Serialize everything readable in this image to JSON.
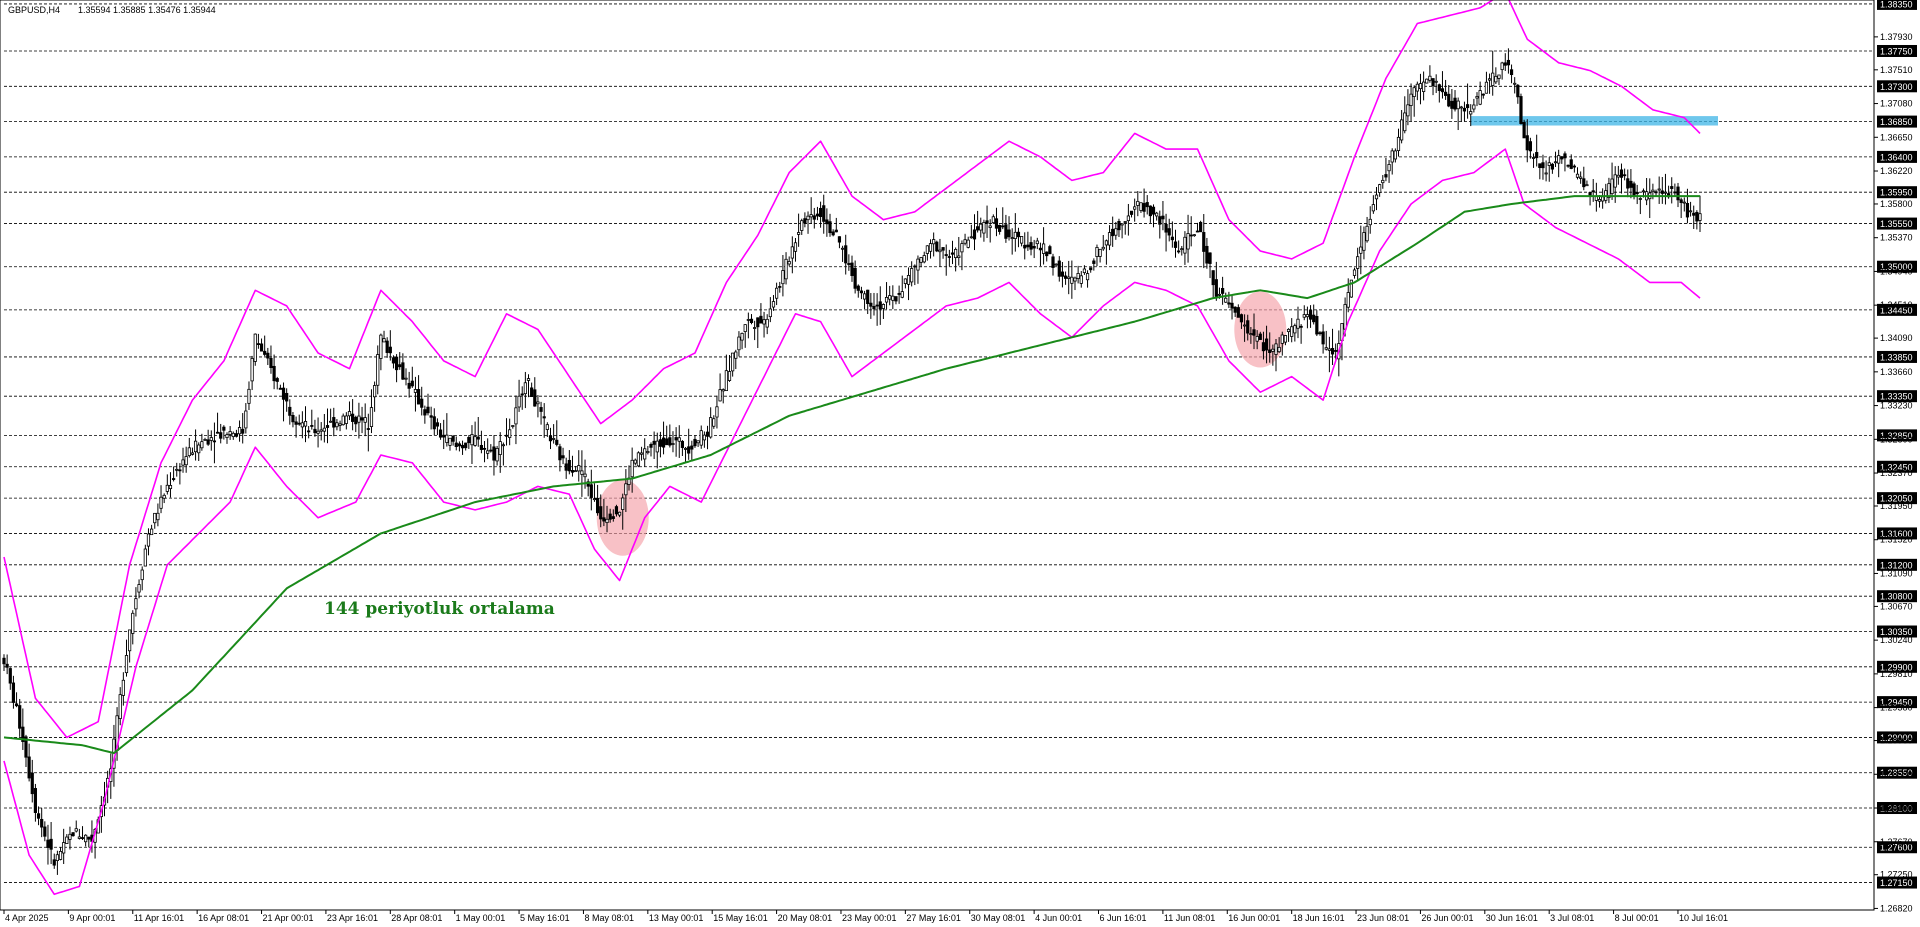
{
  "header": {
    "symbol": "GBPUSD,H4",
    "ohlc": "1.35594 1.35885 1.35476 1.35944"
  },
  "annotation": {
    "ma_label": "144 periyotluk ortalama"
  },
  "colors": {
    "candle": "#000000",
    "bollinger": "#ff00ff",
    "ma": "#1a8a1a",
    "resistance_band": "#3db4e6",
    "highlight": "#f4a0a8"
  },
  "chart_data": {
    "type": "candlestick",
    "symbol": "GBPUSD,H4",
    "ylim": [
      1.268,
      1.384
    ],
    "grid": "horizontal dashed at level lines",
    "y_levels": [
      "1.38350",
      "1.37750",
      "1.37300",
      "1.36850",
      "1.36400",
      "1.35950",
      "1.35550",
      "1.35000",
      "1.34450",
      "1.33850",
      "1.33350",
      "1.32850",
      "1.32450",
      "1.32050",
      "1.31600",
      "1.31200",
      "1.30800",
      "1.30350",
      "1.29900",
      "1.29450",
      "1.29000",
      "1.28550",
      "1.28100",
      "1.27600",
      "1.27150"
    ],
    "y_ticks": [
      "1.37930",
      "1.37510",
      "1.37080",
      "1.36650",
      "1.36220",
      "1.35800",
      "1.35370",
      "1.34940",
      "1.34510",
      "1.34090",
      "1.33660",
      "1.33230",
      "1.32800",
      "1.32370",
      "1.31950",
      "1.31520",
      "1.31090",
      "1.30670",
      "1.30240",
      "1.29810",
      "1.29380",
      "1.28960",
      "1.28530",
      "1.28100",
      "1.27670",
      "1.27250",
      "1.26820"
    ],
    "x_labels": [
      "4 Apr 2025",
      "9 Apr 00:01",
      "11 Apr 16:01",
      "16 Apr 08:01",
      "21 Apr 00:01",
      "23 Apr 16:01",
      "28 Apr 08:01",
      "1 May 00:01",
      "5 May 16:01",
      "8 May 08:01",
      "13 May 00:01",
      "15 May 16:01",
      "20 May 08:01",
      "23 May 00:01",
      "27 May 16:01",
      "30 May 08:01",
      "4 Jun 00:01",
      "6 Jun 16:01",
      "11 Jun 08:01",
      "16 Jun 00:01",
      "18 Jun 16:01",
      "23 Jun 08:01",
      "26 Jun 00:01",
      "30 Jun 16:01",
      "3 Jul 08:01",
      "8 Jul 00:01",
      "10 Jul 16:01"
    ],
    "price_path": [
      [
        0,
        1.3
      ],
      [
        6,
        1.29
      ],
      [
        10,
        1.281
      ],
      [
        16,
        1.274
      ],
      [
        22,
        1.278
      ],
      [
        28,
        1.277
      ],
      [
        34,
        1.286
      ],
      [
        40,
        1.304
      ],
      [
        46,
        1.316
      ],
      [
        52,
        1.322
      ],
      [
        58,
        1.326
      ],
      [
        64,
        1.328
      ],
      [
        70,
        1.329
      ],
      [
        76,
        1.329
      ],
      [
        80,
        1.341
      ],
      [
        86,
        1.336
      ],
      [
        92,
        1.331
      ],
      [
        98,
        1.329
      ],
      [
        104,
        1.33
      ],
      [
        110,
        1.331
      ],
      [
        116,
        1.33
      ],
      [
        120,
        1.341
      ],
      [
        126,
        1.337
      ],
      [
        132,
        1.333
      ],
      [
        138,
        1.329
      ],
      [
        144,
        1.327
      ],
      [
        150,
        1.328
      ],
      [
        156,
        1.326
      ],
      [
        162,
        1.33
      ],
      [
        166,
        1.336
      ],
      [
        172,
        1.33
      ],
      [
        178,
        1.325
      ],
      [
        184,
        1.324
      ],
      [
        190,
        1.318
      ],
      [
        196,
        1.319
      ],
      [
        200,
        1.325
      ],
      [
        206,
        1.327
      ],
      [
        212,
        1.328
      ],
      [
        218,
        1.327
      ],
      [
        224,
        1.329
      ],
      [
        230,
        1.336
      ],
      [
        236,
        1.343
      ],
      [
        242,
        1.343
      ],
      [
        248,
        1.349
      ],
      [
        254,
        1.356
      ],
      [
        260,
        1.357
      ],
      [
        266,
        1.353
      ],
      [
        272,
        1.347
      ],
      [
        278,
        1.345
      ],
      [
        284,
        1.346
      ],
      [
        290,
        1.35
      ],
      [
        296,
        1.353
      ],
      [
        302,
        1.351
      ],
      [
        308,
        1.354
      ],
      [
        314,
        1.356
      ],
      [
        320,
        1.354
      ],
      [
        326,
        1.353
      ],
      [
        332,
        1.352
      ],
      [
        338,
        1.348
      ],
      [
        344,
        1.349
      ],
      [
        350,
        1.353
      ],
      [
        356,
        1.356
      ],
      [
        362,
        1.358
      ],
      [
        368,
        1.356
      ],
      [
        374,
        1.352
      ],
      [
        380,
        1.355
      ],
      [
        386,
        1.347
      ],
      [
        392,
        1.344
      ],
      [
        398,
        1.341
      ],
      [
        404,
        1.339
      ],
      [
        410,
        1.342
      ],
      [
        416,
        1.344
      ],
      [
        420,
        1.34
      ],
      [
        424,
        1.339
      ],
      [
        430,
        1.35
      ],
      [
        436,
        1.358
      ],
      [
        442,
        1.364
      ],
      [
        448,
        1.372
      ],
      [
        454,
        1.374
      ],
      [
        460,
        1.371
      ],
      [
        466,
        1.37
      ],
      [
        472,
        1.373
      ],
      [
        478,
        1.376
      ],
      [
        482,
        1.372
      ],
      [
        484,
        1.366
      ],
      [
        490,
        1.362
      ],
      [
        496,
        1.364
      ],
      [
        502,
        1.361
      ],
      [
        508,
        1.358
      ],
      [
        514,
        1.362
      ],
      [
        520,
        1.359
      ],
      [
        526,
        1.359
      ],
      [
        532,
        1.36
      ],
      [
        536,
        1.357
      ],
      [
        540,
        1.356
      ]
    ],
    "candle_count": 541,
    "xlim_index": [
      0,
      540
    ],
    "ma_path": [
      [
        0,
        1.29
      ],
      [
        25,
        1.289
      ],
      [
        35,
        1.288
      ],
      [
        60,
        1.296
      ],
      [
        90,
        1.309
      ],
      [
        120,
        1.316
      ],
      [
        150,
        1.32
      ],
      [
        175,
        1.322
      ],
      [
        200,
        1.323
      ],
      [
        225,
        1.326
      ],
      [
        250,
        1.331
      ],
      [
        275,
        1.334
      ],
      [
        300,
        1.337
      ],
      [
        330,
        1.34
      ],
      [
        360,
        1.343
      ],
      [
        385,
        1.346
      ],
      [
        400,
        1.347
      ],
      [
        415,
        1.346
      ],
      [
        430,
        1.348
      ],
      [
        450,
        1.353
      ],
      [
        465,
        1.357
      ],
      [
        480,
        1.358
      ],
      [
        500,
        1.359
      ],
      [
        520,
        1.359
      ],
      [
        540,
        1.359
      ]
    ],
    "bollinger_upper": [
      [
        0,
        1.313
      ],
      [
        10,
        1.295
      ],
      [
        20,
        1.29
      ],
      [
        30,
        1.292
      ],
      [
        40,
        1.312
      ],
      [
        50,
        1.325
      ],
      [
        60,
        1.333
      ],
      [
        70,
        1.338
      ],
      [
        80,
        1.347
      ],
      [
        90,
        1.345
      ],
      [
        100,
        1.339
      ],
      [
        110,
        1.337
      ],
      [
        120,
        1.347
      ],
      [
        130,
        1.343
      ],
      [
        140,
        1.338
      ],
      [
        150,
        1.336
      ],
      [
        160,
        1.344
      ],
      [
        170,
        1.342
      ],
      [
        180,
        1.336
      ],
      [
        190,
        1.33
      ],
      [
        200,
        1.333
      ],
      [
        210,
        1.337
      ],
      [
        220,
        1.339
      ],
      [
        230,
        1.348
      ],
      [
        240,
        1.354
      ],
      [
        250,
        1.362
      ],
      [
        260,
        1.366
      ],
      [
        270,
        1.359
      ],
      [
        280,
        1.356
      ],
      [
        290,
        1.357
      ],
      [
        300,
        1.36
      ],
      [
        310,
        1.363
      ],
      [
        320,
        1.366
      ],
      [
        330,
        1.364
      ],
      [
        340,
        1.361
      ],
      [
        350,
        1.362
      ],
      [
        360,
        1.367
      ],
      [
        370,
        1.365
      ],
      [
        380,
        1.365
      ],
      [
        390,
        1.356
      ],
      [
        400,
        1.352
      ],
      [
        410,
        1.351
      ],
      [
        420,
        1.353
      ],
      [
        430,
        1.364
      ],
      [
        440,
        1.374
      ],
      [
        450,
        1.381
      ],
      [
        460,
        1.382
      ],
      [
        470,
        1.383
      ],
      [
        478,
        1.385
      ],
      [
        485,
        1.379
      ],
      [
        495,
        1.376
      ],
      [
        505,
        1.375
      ],
      [
        515,
        1.373
      ],
      [
        525,
        1.37
      ],
      [
        535,
        1.369
      ],
      [
        540,
        1.367
      ]
    ],
    "bollinger_lower": [
      [
        0,
        1.287
      ],
      [
        8,
        1.275
      ],
      [
        16,
        1.27
      ],
      [
        24,
        1.271
      ],
      [
        32,
        1.282
      ],
      [
        42,
        1.299
      ],
      [
        52,
        1.312
      ],
      [
        62,
        1.316
      ],
      [
        72,
        1.32
      ],
      [
        80,
        1.327
      ],
      [
        90,
        1.322
      ],
      [
        100,
        1.318
      ],
      [
        112,
        1.32
      ],
      [
        120,
        1.326
      ],
      [
        130,
        1.325
      ],
      [
        140,
        1.32
      ],
      [
        150,
        1.319
      ],
      [
        160,
        1.32
      ],
      [
        170,
        1.322
      ],
      [
        180,
        1.321
      ],
      [
        188,
        1.314
      ],
      [
        196,
        1.31
      ],
      [
        204,
        1.318
      ],
      [
        212,
        1.322
      ],
      [
        222,
        1.32
      ],
      [
        232,
        1.328
      ],
      [
        242,
        1.336
      ],
      [
        252,
        1.344
      ],
      [
        260,
        1.343
      ],
      [
        270,
        1.336
      ],
      [
        280,
        1.339
      ],
      [
        290,
        1.342
      ],
      [
        300,
        1.345
      ],
      [
        310,
        1.346
      ],
      [
        320,
        1.348
      ],
      [
        330,
        1.344
      ],
      [
        340,
        1.341
      ],
      [
        350,
        1.345
      ],
      [
        360,
        1.348
      ],
      [
        370,
        1.347
      ],
      [
        380,
        1.345
      ],
      [
        390,
        1.338
      ],
      [
        400,
        1.334
      ],
      [
        410,
        1.336
      ],
      [
        420,
        1.333
      ],
      [
        428,
        1.343
      ],
      [
        438,
        1.352
      ],
      [
        448,
        1.358
      ],
      [
        458,
        1.361
      ],
      [
        468,
        1.362
      ],
      [
        478,
        1.365
      ],
      [
        484,
        1.358
      ],
      [
        494,
        1.355
      ],
      [
        504,
        1.353
      ],
      [
        514,
        1.351
      ],
      [
        524,
        1.348
      ],
      [
        534,
        1.348
      ],
      [
        540,
        1.346
      ]
    ],
    "resistance_band": {
      "from_index": 467,
      "to_index": 540,
      "y_low": 1.368,
      "y_high": 1.3692
    },
    "highlights": [
      {
        "index": 197,
        "price": 1.318
      },
      {
        "index": 400,
        "price": 1.342
      }
    ]
  }
}
